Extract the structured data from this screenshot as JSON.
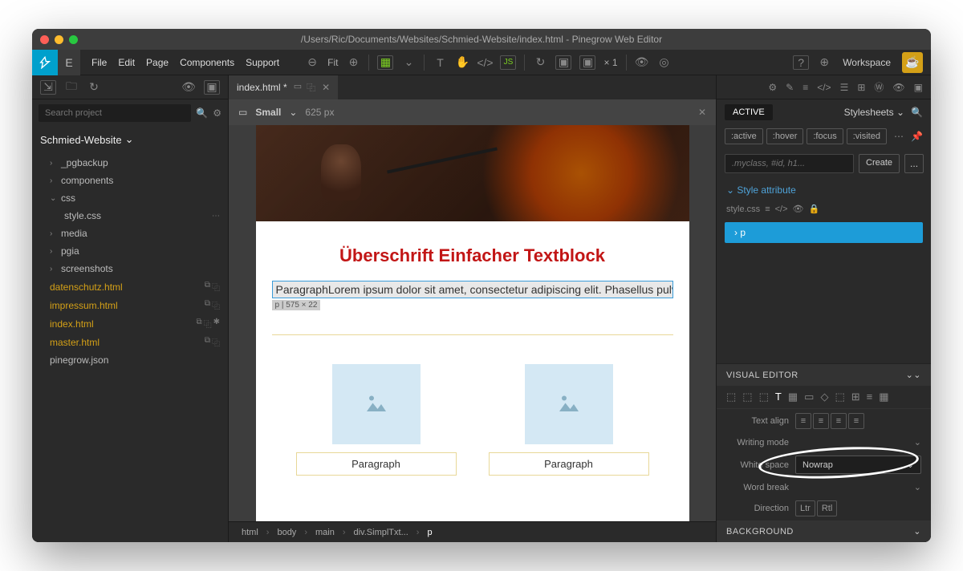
{
  "titlebar": {
    "path": "/Users/Ric/Documents/Websites/Schmied-Website/index.html - Pinegrow Web Editor"
  },
  "menu": {
    "items": [
      "File",
      "Edit",
      "Page",
      "Components",
      "Support"
    ],
    "fit": "Fit",
    "zoom": "× 1",
    "workspace": "Workspace"
  },
  "search": {
    "placeholder": "Search project"
  },
  "project": {
    "name": "Schmied-Website"
  },
  "tree": {
    "items": [
      {
        "label": "_pgbackup",
        "type": "folder",
        "arrow": "›"
      },
      {
        "label": "components",
        "type": "folder",
        "arrow": "›"
      },
      {
        "label": "css",
        "type": "folder",
        "arrow": "⌄",
        "children": [
          {
            "label": "style.css"
          }
        ]
      },
      {
        "label": "media",
        "type": "folder",
        "arrow": "›"
      },
      {
        "label": "pgia",
        "type": "folder",
        "arrow": "›"
      },
      {
        "label": "screenshots",
        "type": "folder",
        "arrow": "›"
      },
      {
        "label": "datenschutz.html",
        "orange": true,
        "icons": true
      },
      {
        "label": "impressum.html",
        "orange": true,
        "icons": true
      },
      {
        "label": "index.html",
        "orange": true,
        "icons": true,
        "star": true
      },
      {
        "label": "master.html",
        "orange": true,
        "icons": true
      },
      {
        "label": "pinegrow.json"
      }
    ]
  },
  "tab": {
    "label": "index.html *"
  },
  "canvas": {
    "device": "Small",
    "width": "625 px",
    "heading": "Überschrift Einfacher Textblock",
    "paragraph": "ParagraphLorem ipsum dolor sit amet, consectetur adipiscing elit. Phasellus pulv",
    "badge": "p | 575 × 22",
    "block_label": "Paragraph"
  },
  "breadcrumb": [
    "html",
    "body",
    "main",
    "div.SimplTxt...",
    "p"
  ],
  "styles": {
    "active_tab": "ACTIVE",
    "stylesheets": "Stylesheets",
    "pseudo": [
      ":active",
      ":hover",
      ":focus",
      ":visited"
    ],
    "selector_placeholder": ".myclass, #id, h1...",
    "create": "Create",
    "style_attribute": "Style attribute",
    "stylecss": "style.css",
    "rule": "p"
  },
  "visual_editor": {
    "header": "VISUAL EDITOR",
    "text_align_label": "Text align",
    "writing_mode_label": "Writing mode",
    "white_space_label": "White space",
    "white_space_value": "Nowrap",
    "word_break_label": "Word break",
    "direction_label": "Direction",
    "direction_ltr": "Ltr",
    "direction_rtl": "Rtl",
    "background_header": "BACKGROUND"
  }
}
